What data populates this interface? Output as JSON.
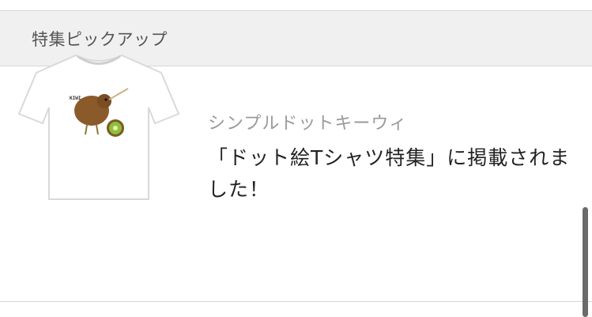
{
  "section": {
    "title": "特集ピックアップ"
  },
  "pickup": {
    "shop_name": "シンプルドットキーウィ",
    "headline": "「ドット絵Tシャツ特集」に掲載されました！",
    "thumbnail": {
      "icon": "tshirt-kiwi-image",
      "print_text": "KIWI"
    }
  },
  "colors": {
    "header_bg": "#f0f0f0",
    "shop_name": "#9a9a9a",
    "headline": "#222222"
  }
}
